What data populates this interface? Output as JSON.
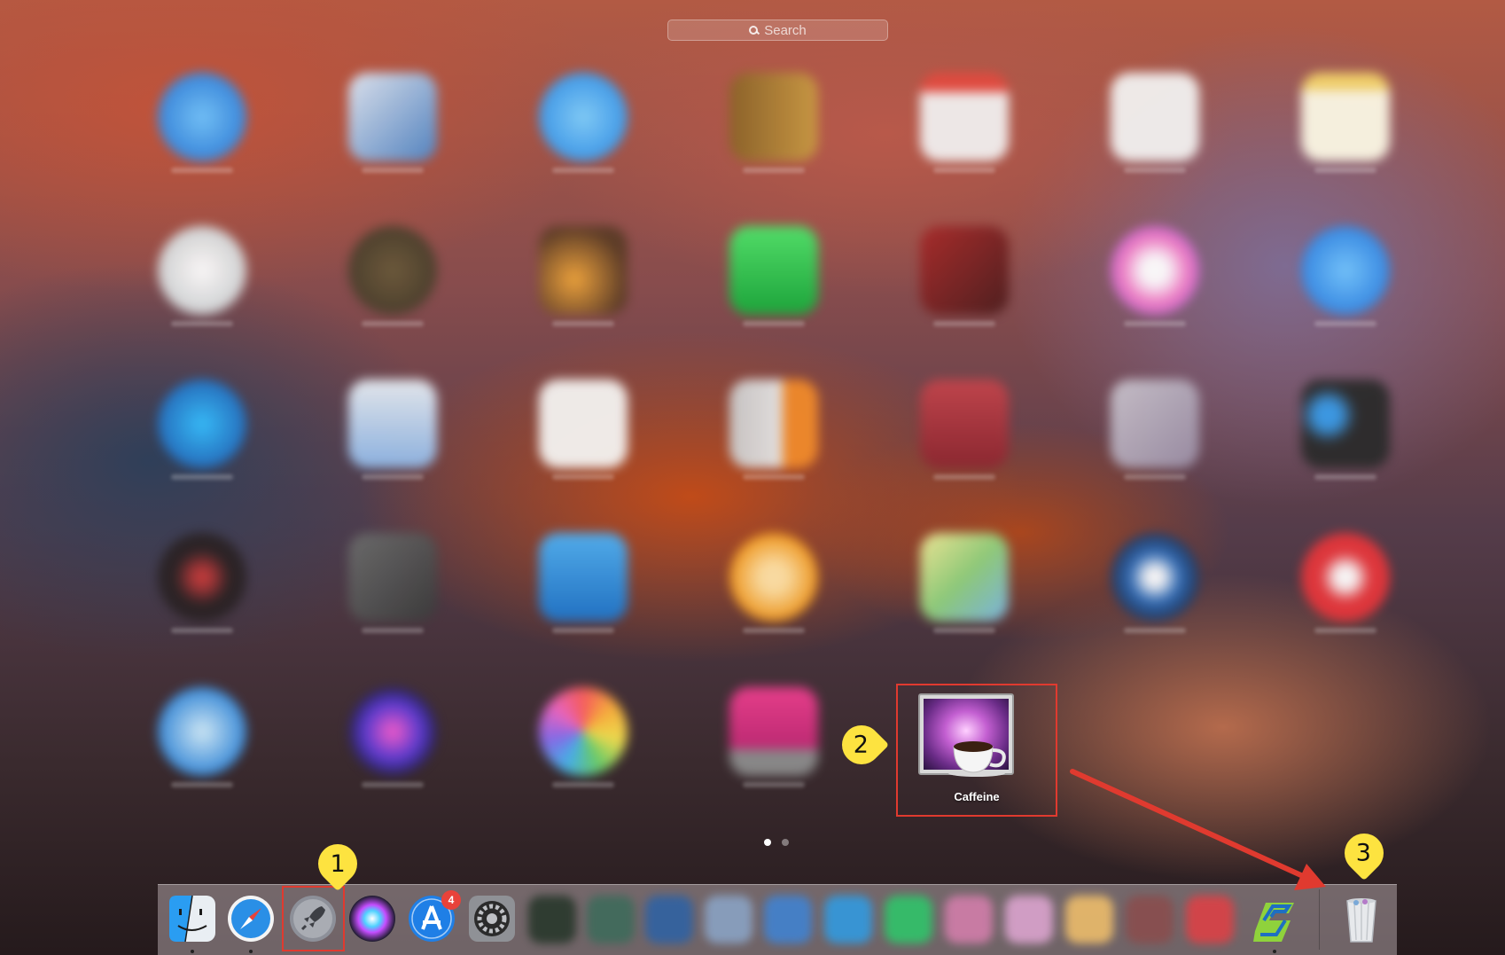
{
  "search": {
    "placeholder": "Search"
  },
  "launchpad_page": {
    "app_icons": [
      "safari-icon",
      "preview-icon",
      "messages-icon",
      "contacts-icon",
      "calendar-icon",
      "reminders-icon",
      "notes-icon",
      "clock-icon",
      "imovie-icon",
      "garageband-icon",
      "facetime-icon",
      "photo-booth-icon",
      "itunes-icon",
      "app-store-icon",
      "network-utility-icon",
      "image-capture-icon",
      "textedit-icon",
      "ibooks-icon",
      "dictionary-icon",
      "mission-control-icon",
      "utilities-folder-icon",
      "dvd-player-icon",
      "chess-icon",
      "folder-icon",
      "ibooks-author-icon",
      "maps-icon",
      "launch-icon",
      "uninstaller-icon",
      "siri-icon",
      "siri-search-icon",
      "photos-icon",
      "display-icon"
    ],
    "highlighted_app": {
      "name": "Caffeine",
      "icon": "caffeine-icon"
    }
  },
  "page_indicator": {
    "pages": 2,
    "current": 1
  },
  "dock": {
    "apps": [
      "finder-icon",
      "safari-icon",
      "launchpad-icon",
      "siri-icon",
      "app-store-icon",
      "system-preferences-icon"
    ],
    "app_store_badge": "4",
    "trash_icon": "trash-icon"
  },
  "annotations": {
    "step1": "1",
    "step2": "2",
    "step3": "3",
    "highlight_color": "#e03a2f",
    "callout_color": "#fde340"
  }
}
